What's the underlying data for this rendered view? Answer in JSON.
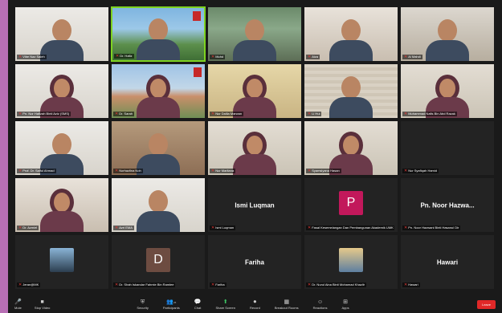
{
  "participants": [
    {
      "name": "Vibe Naz Saleh",
      "muted": true,
      "center_label": "",
      "avatar": "",
      "video": "bg-white"
    },
    {
      "name": "Dr. Hafiz",
      "muted": true,
      "center_label": "",
      "avatar": "",
      "video": "bg-campus"
    },
    {
      "name": "Muhd",
      "muted": true,
      "center_label": "",
      "avatar": "",
      "video": "bg-outdoor"
    },
    {
      "name": "Aiza",
      "muted": true,
      "center_label": "",
      "avatar": "",
      "video": "bg-room"
    },
    {
      "name": "Al Mahdi",
      "muted": true,
      "center_label": "",
      "avatar": "",
      "video": "bg-office"
    },
    {
      "name": "Pn. Nor Hafizah Binti Aziz (SMS)",
      "muted": true,
      "center_label": "",
      "avatar": "",
      "video": "bg-white"
    },
    {
      "name": "Dr. Sarah",
      "muted": true,
      "center_label": "",
      "avatar": "",
      "video": "bg-campus2"
    },
    {
      "name": "Nur Dalila Marwan",
      "muted": true,
      "center_label": "",
      "avatar": "",
      "video": "bg-yellow"
    },
    {
      "name": "Li Hui",
      "muted": true,
      "center_label": "",
      "avatar": "",
      "video": "bg-blinds"
    },
    {
      "name": "Muhammad Nafis Bin Abd Razak",
      "muted": true,
      "center_label": "",
      "avatar": "",
      "video": "bg-wall"
    },
    {
      "name": "Prof. Dr. Saiful Ahmad",
      "muted": true,
      "center_label": "",
      "avatar": "",
      "video": "bg-white"
    },
    {
      "name": "Norhazlina Noh",
      "muted": true,
      "center_label": "",
      "avatar": "",
      "video": "bg-shelf"
    },
    {
      "name": "Nur Marliana",
      "muted": true,
      "center_label": "",
      "avatar": "",
      "video": "bg-wall"
    },
    {
      "name": "Syamsiyana Hasan",
      "muted": true,
      "center_label": "",
      "avatar": "",
      "video": "bg-wall"
    },
    {
      "name": "Nur Syafiqah Hamid",
      "muted": true,
      "center_label": "",
      "avatar": "",
      "video": "bg-dark"
    },
    {
      "name": "Dr. Azmiel",
      "muted": true,
      "center_label": "",
      "avatar": "",
      "video": "bg-room"
    },
    {
      "name": "Azri EMA",
      "muted": true,
      "center_label": "",
      "avatar": "",
      "video": "bg-white"
    },
    {
      "name": "Ismi Luqman",
      "muted": true,
      "center_label": "Ismi Luqman",
      "avatar": "",
      "video": "bg-dark"
    },
    {
      "name": "Fasal Kesemelangan Dan Pembangunan Akademik UMK",
      "muted": true,
      "center_label": "",
      "avatar": "P",
      "video": "bg-dark"
    },
    {
      "name": "Pn. Noor Hazwani Binti Hasanul Dir",
      "muted": true,
      "center_label": "Pn. Noor Hazwa...",
      "avatar": "",
      "video": "bg-dark"
    },
    {
      "name": "Jeran@MK",
      "muted": true,
      "center_label": "",
      "avatar": "thumb-hijab",
      "video": "bg-dark"
    },
    {
      "name": "Dr. Shah Iskandar Fahmie Bin Ramlee",
      "muted": true,
      "center_label": "",
      "avatar": "D",
      "video": "bg-dark"
    },
    {
      "name": "Fariha",
      "muted": true,
      "center_label": "Fariha",
      "avatar": "",
      "video": "bg-dark"
    },
    {
      "name": "Dr. Nurul Aina Binti Mohamad Khazlir",
      "muted": true,
      "center_label": "",
      "avatar": "thumb-sea",
      "video": "bg-dark"
    },
    {
      "name": "Hawari",
      "muted": true,
      "center_label": "Hawari",
      "avatar": "",
      "video": "bg-dark"
    }
  ],
  "toolbar": {
    "mute": "Mute",
    "stop_video": "Stop Video",
    "security": "Security",
    "participants": "Participants",
    "participants_count": "25",
    "chat": "Chat",
    "share_screen": "Share Screen",
    "record": "Record",
    "breakout_rooms": "Breakout Rooms",
    "reactions": "Reactions",
    "apps": "Apps",
    "end": "Leave"
  }
}
